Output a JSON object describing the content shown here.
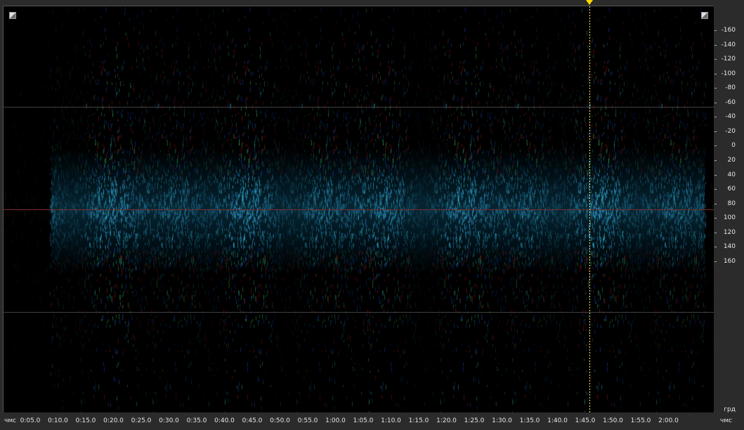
{
  "view": "spectral-pan",
  "colors": {
    "background": "#000000",
    "panel": "#2b2b2b",
    "cursor": "#ffe96a",
    "playhead": "#ffd800",
    "center_line": "#7a2a2a",
    "boundary_lines": "#6b6b6b"
  },
  "x_axis": {
    "unit_left": "чмс",
    "unit_right": "чмс",
    "labels": [
      "0:05.0",
      "0:10.0",
      "0:15.0",
      "0:20.0",
      "0:25.0",
      "0:30.0",
      "0:35.0",
      "0:40.0",
      "0:45.0",
      "0:50.0",
      "0:55.0",
      "1:00.0",
      "1:05.0",
      "1:10.0",
      "1:15.0",
      "1:20.0",
      "1:25.0",
      "1:30.0",
      "1:35.0",
      "1:40.0",
      "1:45.0",
      "1:50.0",
      "1:55.0",
      "2:00.0"
    ]
  },
  "y_axis": {
    "unit": "грд",
    "labels": [
      "-160",
      "-140",
      "-120",
      "-100",
      "-80",
      "-60",
      "-40",
      "-20",
      "0",
      "20",
      "40",
      "60",
      "80",
      "100",
      "120",
      "140",
      "160"
    ]
  },
  "cursor_time": "1:45.0",
  "icons": {
    "top_left": "zoom-corner-icon",
    "top_right": "zoom-corner-icon"
  }
}
